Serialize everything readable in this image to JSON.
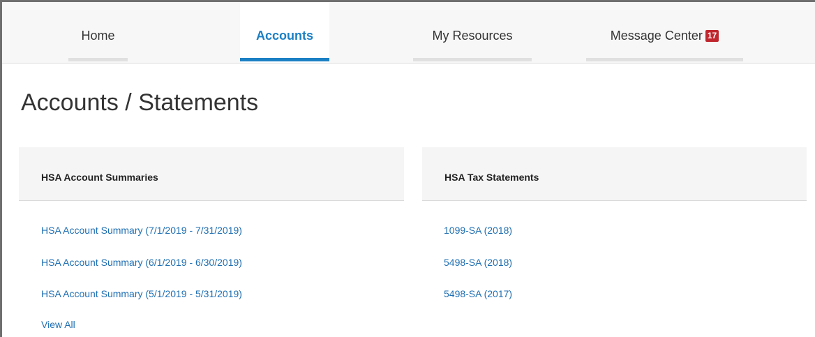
{
  "nav": {
    "tabs": [
      {
        "label": "Home",
        "active": false
      },
      {
        "label": "Accounts",
        "active": true
      },
      {
        "label": "My Resources",
        "active": false
      },
      {
        "label": "Message Center",
        "active": false,
        "badge": "17"
      }
    ]
  },
  "page_title": "Accounts / Statements",
  "summaries": {
    "title": "HSA Account Summaries",
    "items": [
      "HSA Account Summary (7/1/2019 - 7/31/2019)",
      "HSA Account Summary (6/1/2019 - 6/30/2019)",
      "HSA Account Summary (5/1/2019 - 5/31/2019)"
    ],
    "view_all": "View All"
  },
  "tax": {
    "title": "HSA Tax Statements",
    "items": [
      "1099-SA (2018)",
      "5498-SA (2018)",
      "5498-SA (2017)"
    ]
  },
  "colors": {
    "accent": "#1b80c4",
    "link": "#1f6fb2",
    "badge": "#c0262d"
  }
}
